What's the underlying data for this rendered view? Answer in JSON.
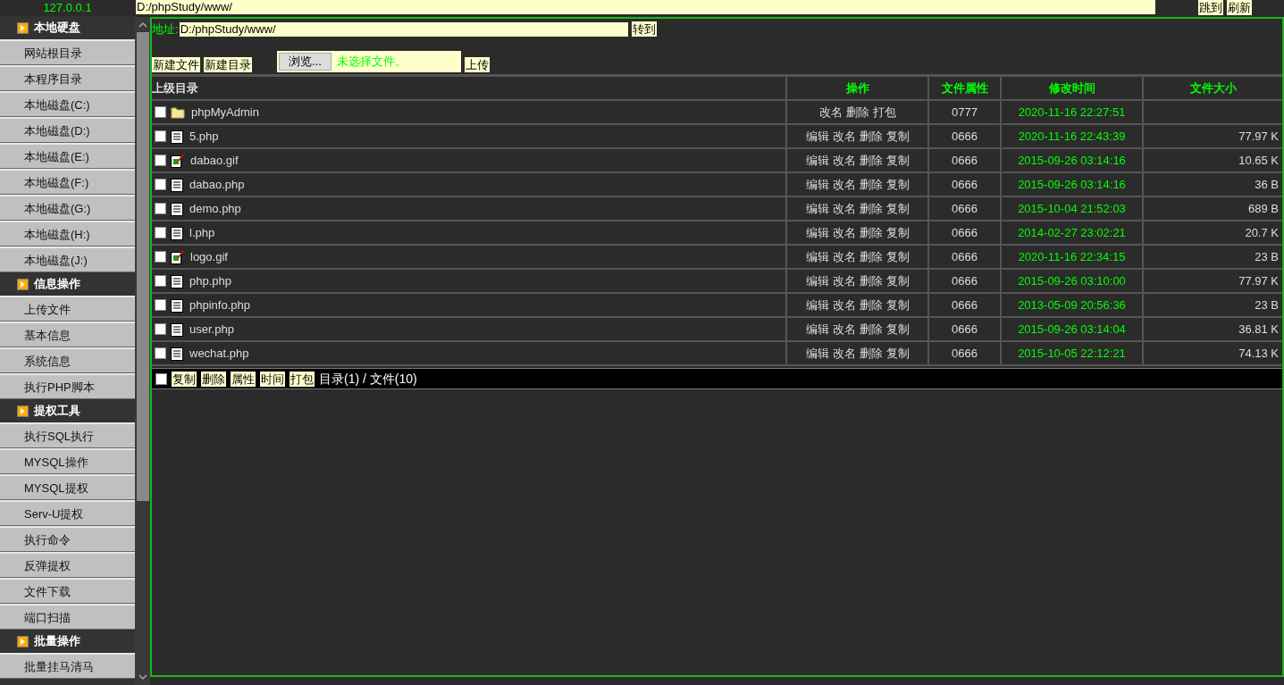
{
  "host": "127.0.0.1",
  "top_bar": {
    "path": "D:/phpStudy/www/",
    "buttons": [
      "跳到",
      "刷新"
    ]
  },
  "sidebar": [
    {
      "title": "本地硬盘",
      "items": [
        "网站根目录",
        "本程序目录",
        "本地磁盘(C:)",
        "本地磁盘(D:)",
        "本地磁盘(E:)",
        "本地磁盘(F:)",
        "本地磁盘(G:)",
        "本地磁盘(H:)",
        "本地磁盘(J:)"
      ]
    },
    {
      "title": "信息操作",
      "items": [
        "上传文件",
        "基本信息",
        "系统信息",
        "执行PHP脚本"
      ]
    },
    {
      "title": "提权工具",
      "items": [
        "执行SQL执行",
        "MYSQL操作",
        "MYSQL提权",
        "Serv-U提权",
        "执行命令",
        "反弹提权",
        "文件下载",
        "端口扫描"
      ]
    },
    {
      "title": "批量操作",
      "items": [
        "批量挂马清马"
      ]
    }
  ],
  "address": {
    "label": "地址:",
    "value": "D:/phpStudy/www/",
    "button": "转到"
  },
  "toolbar": {
    "buttons": [
      "新建文件",
      "新建目录"
    ],
    "browse": "浏览...",
    "file_status": "未选择文件。",
    "upload": "上传"
  },
  "table": {
    "columns": [
      "上级目录",
      "操作",
      "文件属性",
      "修改时间",
      "文件大小"
    ],
    "rows": [
      {
        "checked": false,
        "kind": "folder",
        "name": "phpMyAdmin",
        "actions": [
          "改名",
          "删除",
          "打包"
        ],
        "attr": "0777",
        "time": "2020-11-16 22:27:51"
      },
      {
        "checked": false,
        "kind": "text",
        "name": "5.php",
        "actions": [
          "编辑",
          "改名",
          "删除",
          "复制"
        ],
        "attr": "0666",
        "time": "2020-11-16 22:43:39",
        "size": "77.97 K"
      },
      {
        "checked": false,
        "kind": "image",
        "name": "dabao.gif",
        "actions": [
          "编辑",
          "改名",
          "删除",
          "复制"
        ],
        "attr": "0666",
        "time": "2015-09-26 03:14:16",
        "size": "10.65 K"
      },
      {
        "checked": false,
        "kind": "text",
        "name": "dabao.php",
        "actions": [
          "编辑",
          "改名",
          "删除",
          "复制"
        ],
        "attr": "0666",
        "time": "2015-09-26 03:14:16",
        "size": "36 B"
      },
      {
        "checked": false,
        "kind": "text",
        "name": "demo.php",
        "actions": [
          "编辑",
          "改名",
          "删除",
          "复制"
        ],
        "attr": "0666",
        "time": "2015-10-04 21:52:03",
        "size": "689 B"
      },
      {
        "checked": false,
        "kind": "text",
        "name": "l.php",
        "actions": [
          "编辑",
          "改名",
          "删除",
          "复制"
        ],
        "attr": "0666",
        "time": "2014-02-27 23:02:21",
        "size": "20.7 K"
      },
      {
        "checked": false,
        "kind": "image",
        "name": "logo.gif",
        "actions": [
          "编辑",
          "改名",
          "删除",
          "复制"
        ],
        "attr": "0666",
        "time": "2020-11-16 22:34:15",
        "size": "23 B"
      },
      {
        "checked": false,
        "kind": "text",
        "name": "php.php",
        "actions": [
          "编辑",
          "改名",
          "删除",
          "复制"
        ],
        "attr": "0666",
        "time": "2015-09-26 03:10:00",
        "size": "77.97 K"
      },
      {
        "checked": false,
        "kind": "text",
        "name": "phpinfo.php",
        "actions": [
          "编辑",
          "改名",
          "删除",
          "复制"
        ],
        "attr": "0666",
        "time": "2013-05-09 20:56:36",
        "size": "23 B"
      },
      {
        "checked": false,
        "kind": "text",
        "name": "user.php",
        "actions": [
          "编辑",
          "改名",
          "删除",
          "复制"
        ],
        "attr": "0666",
        "time": "2015-09-26 03:14:04",
        "size": "36.81 K"
      },
      {
        "checked": false,
        "kind": "text",
        "name": "wechat.php",
        "actions": [
          "编辑",
          "改名",
          "删除",
          "复制"
        ],
        "attr": "0666",
        "time": "2015-10-05 22:12:21",
        "size": "74.13 K"
      }
    ]
  },
  "footer": {
    "checked": false,
    "buttons": [
      "复制",
      "删除",
      "属性",
      "时间",
      "打包"
    ],
    "summary": "目录(1) / 文件(10)"
  }
}
